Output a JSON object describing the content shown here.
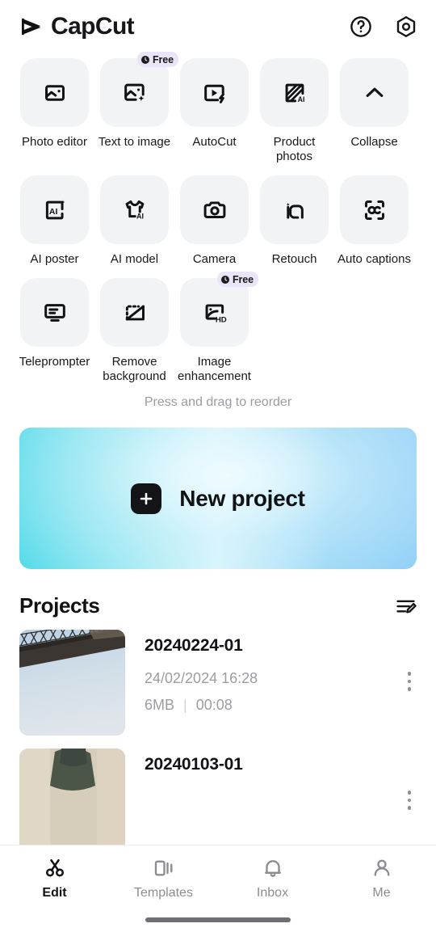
{
  "header": {
    "brand_name": "CapCut",
    "brand_icon": "capcut-logo-icon",
    "help_icon": "help-circle-icon",
    "settings_icon": "settings-gear-icon"
  },
  "tools": {
    "reorder_hint": "Press and drag to reorder",
    "free_badge_label": "Free",
    "rows": [
      [
        {
          "label": "Photo editor",
          "icon": "photo-editor-icon",
          "badge": ""
        },
        {
          "label": "Text to image",
          "icon": "text-to-image-icon",
          "badge": "Free"
        },
        {
          "label": "AutoCut",
          "icon": "autocut-icon",
          "badge": ""
        },
        {
          "label": "Product photos",
          "icon": "product-photos-icon",
          "badge": ""
        },
        {
          "label": "Collapse",
          "icon": "chevron-up-icon",
          "badge": ""
        }
      ],
      [
        {
          "label": "AI poster",
          "icon": "ai-poster-icon",
          "badge": ""
        },
        {
          "label": "AI model",
          "icon": "ai-model-icon",
          "badge": ""
        },
        {
          "label": "Camera",
          "icon": "camera-icon",
          "badge": ""
        },
        {
          "label": "Retouch",
          "icon": "retouch-icon",
          "badge": ""
        },
        {
          "label": "Auto captions",
          "icon": "auto-captions-icon",
          "badge": ""
        }
      ],
      [
        {
          "label": "Teleprompter",
          "icon": "teleprompter-icon",
          "badge": ""
        },
        {
          "label": "Remove background",
          "icon": "remove-background-icon",
          "badge": ""
        },
        {
          "label": "Image enhancement",
          "icon": "image-enhancement-icon",
          "badge": "Free"
        }
      ]
    ]
  },
  "new_project": {
    "label": "New project",
    "plus_icon": "plus-icon",
    "gradient_start": "#4dd9e8",
    "gradient_mid": "#d9f5fb",
    "gradient_end": "#8ecdf7"
  },
  "projects": {
    "title": "Projects",
    "sort_icon": "sort-edit-icon",
    "items": [
      {
        "name": "20240224-01",
        "date": "24/02/2024 16:28",
        "size": "6MB",
        "separator": "|",
        "duration": "00:08",
        "thumbnail": "bridge-truss-photo",
        "menu_icon": "kebab-menu-icon"
      },
      {
        "name": "20240103-01",
        "date": "",
        "size": "",
        "separator": "",
        "duration": "",
        "thumbnail": "person-photo",
        "menu_icon": "kebab-menu-icon"
      }
    ]
  },
  "bottom_nav": {
    "items": [
      {
        "label": "Edit",
        "icon": "scissors-icon",
        "active": true
      },
      {
        "label": "Templates",
        "icon": "templates-icon",
        "active": false
      },
      {
        "label": "Inbox",
        "icon": "bell-icon",
        "active": false
      },
      {
        "label": "Me",
        "icon": "person-icon",
        "active": false
      }
    ]
  }
}
